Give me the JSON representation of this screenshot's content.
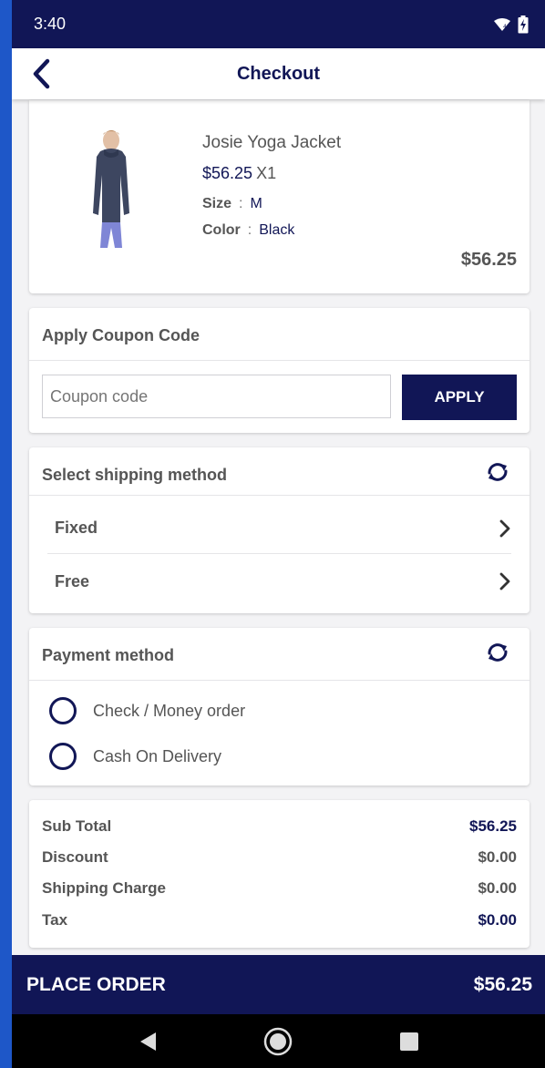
{
  "status_bar": {
    "time": "3:40"
  },
  "header": {
    "title": "Checkout"
  },
  "cart_item": {
    "name": "Josie Yoga Jacket",
    "price": "$56.25",
    "qty": "X1",
    "size_label": "Size",
    "size_value": "M",
    "color_label": "Color",
    "color_value": "Black",
    "separator": ":",
    "line_total": "$56.25"
  },
  "coupon": {
    "title": "Apply Coupon Code",
    "placeholder": "Coupon code",
    "apply_label": "APPLY"
  },
  "shipping": {
    "title": "Select shipping method",
    "options": [
      {
        "label": "Fixed"
      },
      {
        "label": "Free"
      }
    ]
  },
  "payment": {
    "title": "Payment method",
    "options": [
      {
        "label": "Check / Money order",
        "selected": false
      },
      {
        "label": "Cash On Delivery",
        "selected": false
      }
    ]
  },
  "summary": {
    "sub_total_label": "Sub Total",
    "sub_total_value": "$56.25",
    "discount_label": "Discount",
    "discount_value": "$0.00",
    "shipping_label": "Shipping Charge",
    "shipping_value": "$0.00",
    "tax_label": "Tax",
    "tax_value": "$0.00"
  },
  "footer": {
    "place_order_label": "PLACE ORDER",
    "place_order_total": "$56.25"
  },
  "colors": {
    "primary": "#111656",
    "frame": "#1e57c8",
    "background": "#f3f3f5",
    "text_gray": "#555555"
  }
}
